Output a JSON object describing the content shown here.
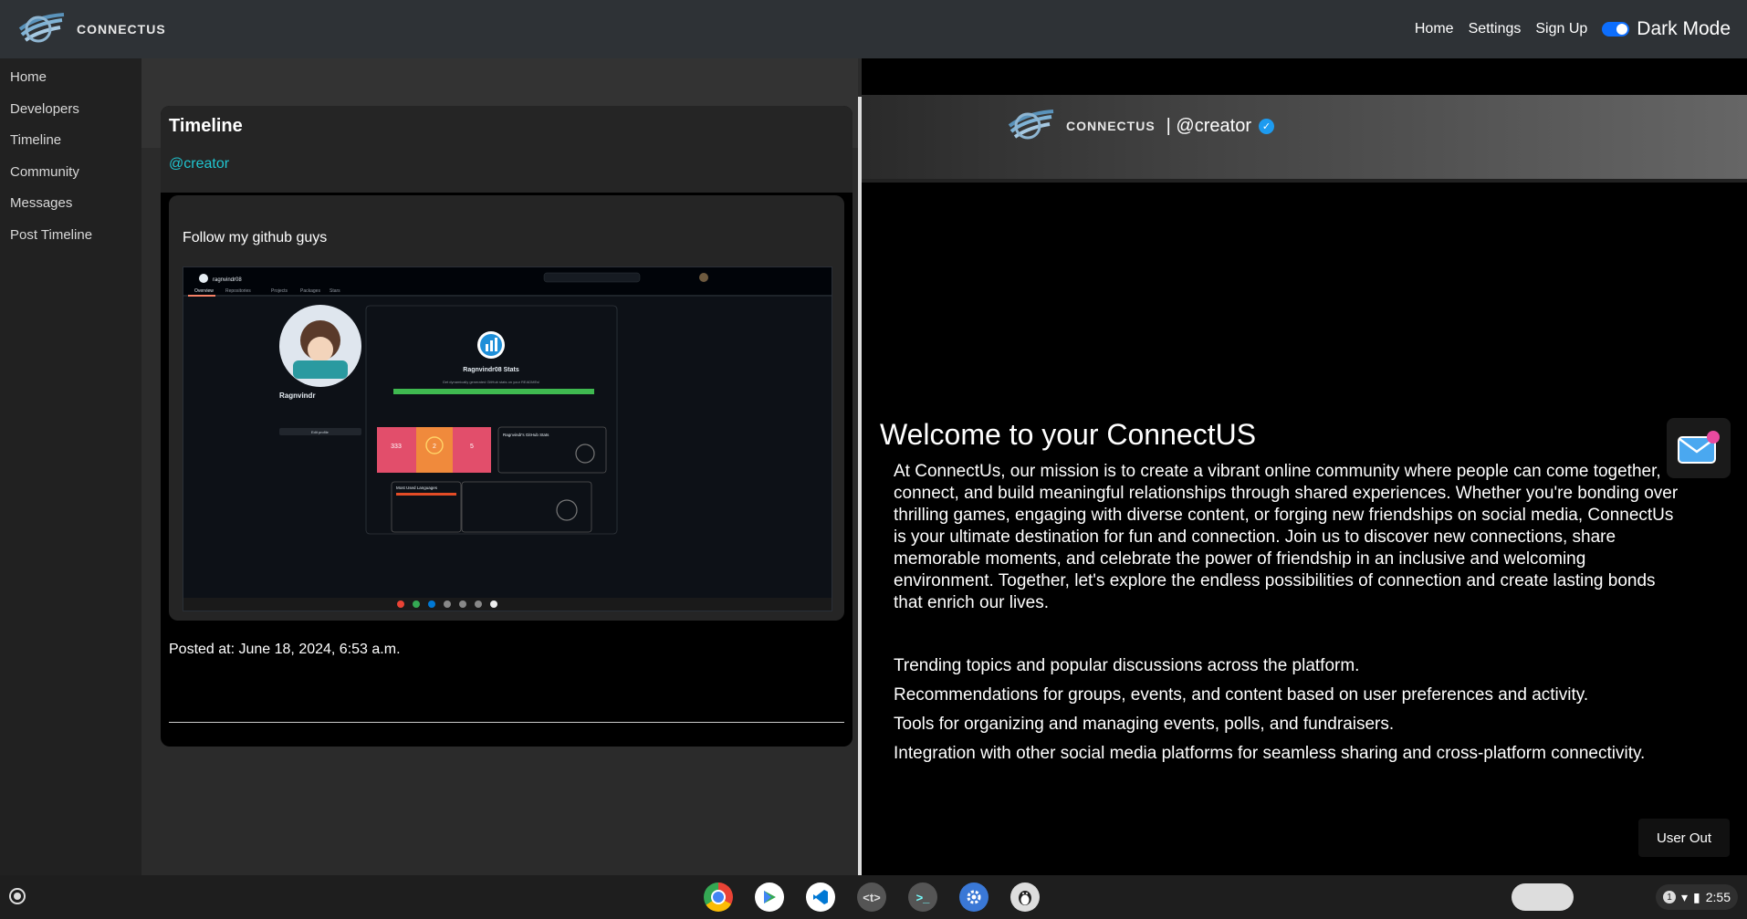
{
  "topbar": {
    "brand": "CONNECTUS",
    "nav": [
      "Home",
      "Settings",
      "Sign Up"
    ],
    "dark_mode_label": "Dark Mode"
  },
  "sidebar": {
    "items": [
      {
        "label": "Home"
      },
      {
        "label": "Developers"
      },
      {
        "label": "Timeline"
      },
      {
        "label": "Community"
      },
      {
        "label": "Messages"
      },
      {
        "label": "Post Timeline"
      }
    ]
  },
  "timeline": {
    "title": "Timeline",
    "user": "@creator",
    "post": {
      "text": "Follow my github guys",
      "image_alt": "GitHub profile screenshot",
      "posted_at": "Posted at: June 18, 2024, 6:53 a.m."
    }
  },
  "screenshot_content": {
    "username": "ragnvindr08",
    "display_name": "Ragnvindr",
    "tabs": [
      "Overview",
      "Repositories",
      "Projects",
      "Packages",
      "Stars"
    ],
    "stats_title": "Ragnvindr08 Stats",
    "stats_subtitle": "Get dynamically generated GitHub stats on your READMEs!",
    "card1": [
      "333",
      "2",
      "5"
    ],
    "card_title": "Ragnvindr's GitHub Stats",
    "langs_title": "Most Used Languages",
    "follow_btn": "Edit profile"
  },
  "right_panel": {
    "brand": "CONNECTUS",
    "handle": "| @creator",
    "welcome_title": "Welcome to your ConnectUS",
    "mission": "At ConnectUs, our mission is to create a vibrant online community where people can come together, connect, and build meaningful relationships through shared experiences. Whether you're bonding over thrilling games, engaging with diverse content, or forging new friendships on social media, ConnectUs is your ultimate destination for fun and connection. Join us to discover new connections, share memorable moments, and celebrate the power of friendship in an inclusive and welcoming environment. Together, let's explore the endless possibilities of connection and create lasting bonds that enrich our lives.",
    "features": [
      "Trending topics and popular discussions across the platform.",
      "Recommendations for groups, events, and content based on user preferences and activity.",
      "Tools for organizing and managing events, polls, and fundraisers.",
      "Integration with other social media platforms for seamless sharing and cross-platform connectivity."
    ],
    "user_out_label": "User Out"
  },
  "shelf": {
    "apps": [
      "chrome-icon",
      "play-store-icon",
      "vscode-icon",
      "text-editor-icon",
      "terminal-icon",
      "settings-icon",
      "penguin-icon"
    ],
    "clock": "2:55",
    "notification_count": "1"
  },
  "colors": {
    "accent": "#20c5d0",
    "toggle": "#0d6efd",
    "verified": "#1d9bf0"
  }
}
